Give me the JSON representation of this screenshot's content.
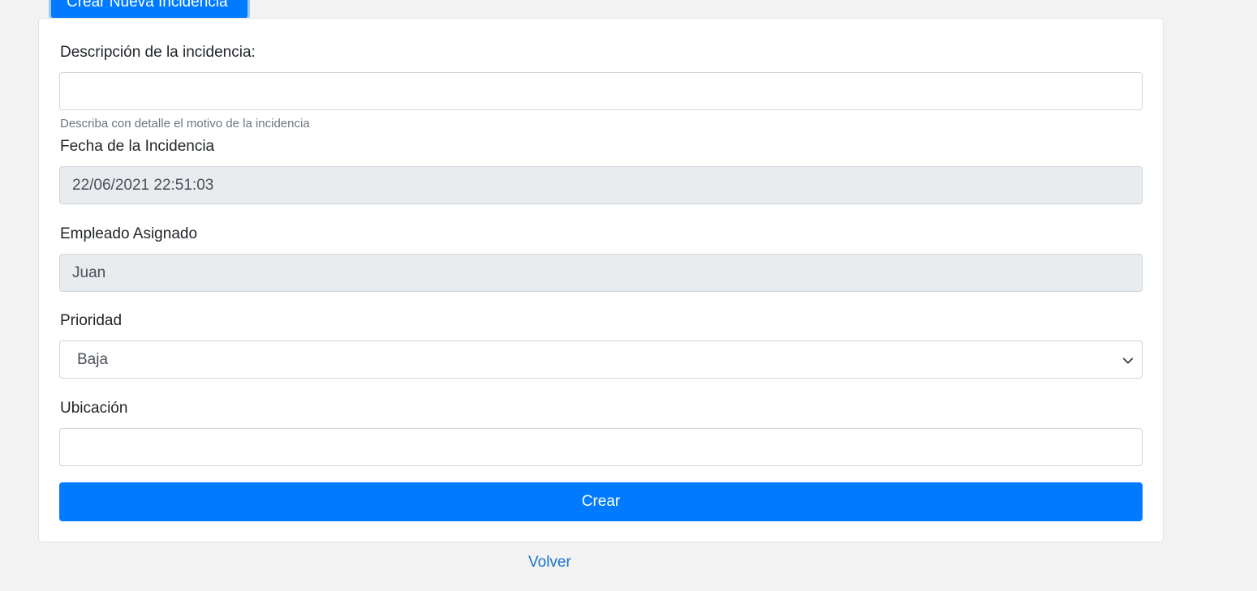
{
  "header": {
    "title": "Crear Nueva Incidencia"
  },
  "form": {
    "descripcion": {
      "label": "Descripción de la incidencia:",
      "value": "",
      "help": "Describa con detalle el motivo de la incidencia"
    },
    "fecha": {
      "label": "Fecha de la Incidencia",
      "value": "22/06/2021 22:51:03"
    },
    "empleado": {
      "label": "Empleado Asignado",
      "value": "Juan"
    },
    "prioridad": {
      "label": "Prioridad",
      "value": "Baja"
    },
    "ubicacion": {
      "label": "Ubicación",
      "value": ""
    },
    "submit_label": "Crear"
  },
  "footer": {
    "back_link": "Volver"
  },
  "colors": {
    "primary": "#007bff",
    "link": "#1a73c9",
    "readonly_bg": "#e9ecef",
    "page_bg": "#f3f3f3"
  },
  "icons": {
    "select_arrow": "chevron-down-icon"
  }
}
